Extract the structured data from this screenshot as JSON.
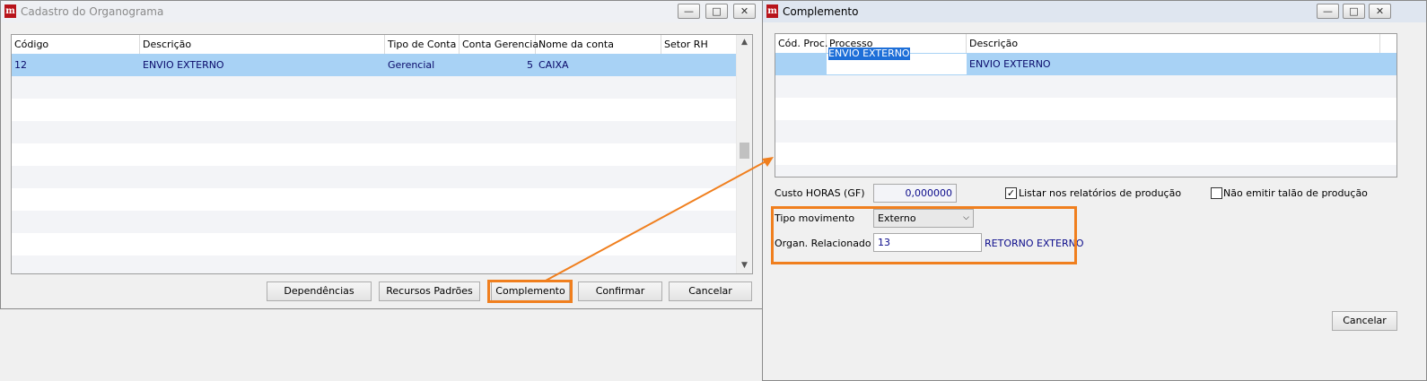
{
  "left_window": {
    "title": "Cadastro do Organograma",
    "columns": [
      "Código",
      "Descrição",
      "Tipo de Conta",
      "Conta Gerencial",
      "Nome da conta",
      "Setor RH"
    ],
    "rows": [
      {
        "codigo": "12",
        "descricao": "ENVIO EXTERNO",
        "tipo_conta": "Gerencial",
        "conta_gerencial": "5",
        "nome_conta": "CAIXA",
        "setor_rh": ""
      }
    ],
    "buttons": {
      "dependencias": "Dependências",
      "recursos_padroes": "Recursos Padrões",
      "complemento": "Complemento",
      "confirmar": "Confirmar",
      "cancelar": "Cancelar"
    }
  },
  "right_window": {
    "title": "Complemento",
    "columns": [
      "Cód. Proc.",
      "Processo",
      "Descrição"
    ],
    "rows": [
      {
        "cod_proc": "",
        "processo": "ENVIO EXTERNO",
        "descricao": "ENVIO EXTERNO"
      }
    ],
    "custo_horas_label": "Custo HORAS (GF)",
    "custo_horas_value": "0,000000",
    "listar_label": "Listar nos relatórios de produção",
    "listar_checked": true,
    "nao_emitir_label": "Não emitir talão de produção",
    "nao_emitir_checked": false,
    "tipo_movimento_label": "Tipo movimento",
    "tipo_movimento_value": "Externo",
    "organ_relacionado_label": "Organ. Relacionado",
    "organ_relacionado_value": "13",
    "organ_relacionado_desc": "RETORNO EXTERNO",
    "cancelar": "Cancelar"
  },
  "colors": {
    "highlight": "#f07f1e",
    "selection": "#a8d2f5",
    "value_text": "#0a0a8a",
    "logo": "#b8141b"
  }
}
